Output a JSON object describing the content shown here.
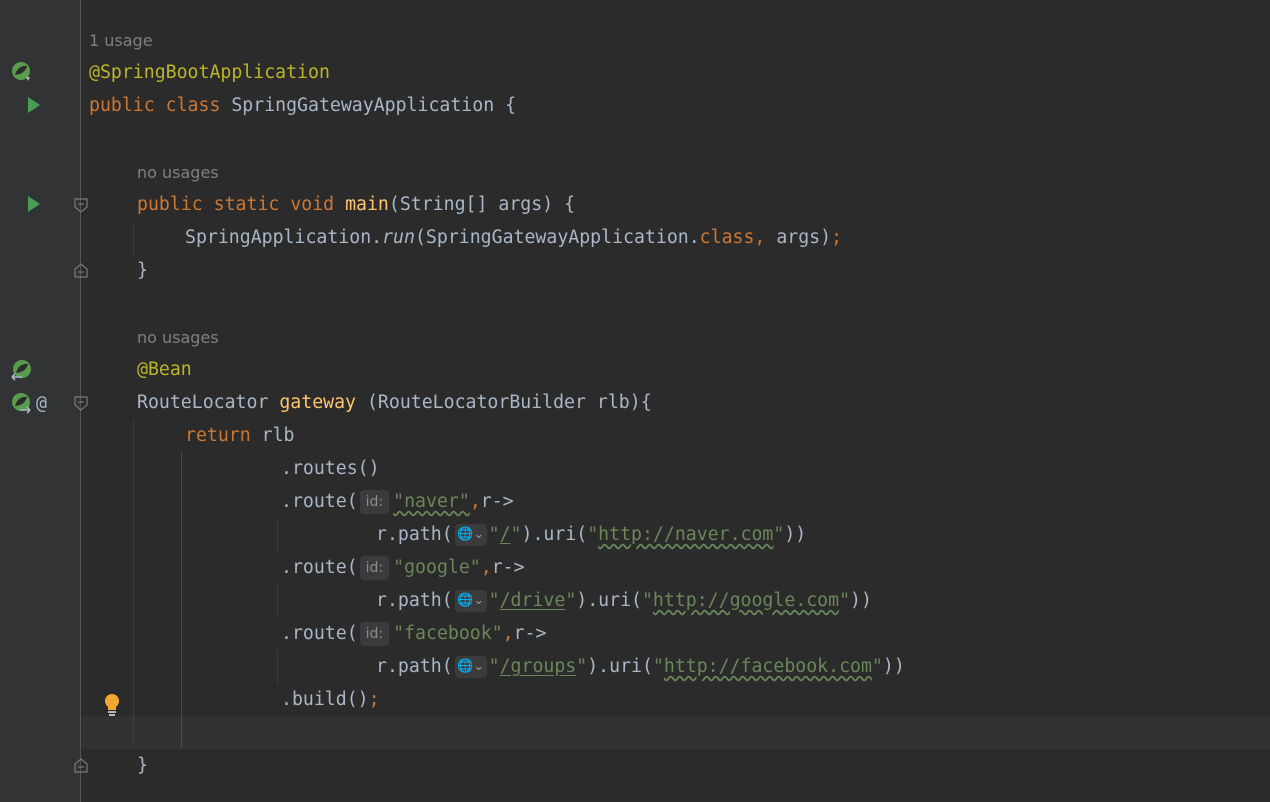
{
  "hints": {
    "class_usage": "1 usage",
    "main_usage": "no usages",
    "gateway_usage": "no usages"
  },
  "code": {
    "l_annotation": "@SpringBootApplication",
    "l_class_public": "public",
    "l_class_class": "class",
    "l_class_name": " SpringGatewayApplication {",
    "l_main_public": "public",
    "l_main_static": "static",
    "l_main_void": "void",
    "l_main_name": "main",
    "l_main_params": "(String[] args) {",
    "l_run_obj": "SpringApplication.",
    "l_run_method": "run",
    "l_run_args": "(SpringGatewayApplication.",
    "l_run_class": "class",
    "l_run_comma": ",",
    "l_run_rest": " args)",
    "l_run_semi": ";",
    "l_close_brace": "}",
    "l_bean": "@Bean",
    "l_gw_type": "RouteLocator ",
    "l_gw_name": "gateway",
    "l_gw_params": " (RouteLocatorBuilder rlb){",
    "l_return": "return",
    "l_rlb": " rlb",
    "l_routes": ".routes()",
    "route_prefix": ".route(",
    "param_hint": "id:",
    "route1_id": "\"naver\"",
    "route2_id": "\"google\"",
    "route3_id": "\"facebook\"",
    "route_comma": ",",
    "route_lambda": "r->",
    "path_prefix": "r.path(",
    "globe_glyph": "🌐⌄",
    "quote": "\"",
    "path1": "/",
    "path2": "/drive",
    "path3": "/groups",
    "uri_mid": ").uri(",
    "uri1": "http://naver.com",
    "uri2": "http://google.com",
    "uri3": "http://facebook.com",
    "uri_end": "))",
    "build": ".build()",
    "build_semi": ";",
    "at_sign": "@"
  },
  "icons": [
    "spring-bean-icon",
    "run-icon",
    "fold-icon",
    "lightbulb-icon"
  ],
  "colors": {
    "background": "#2b2b2b",
    "gutter": "#313335",
    "keyword": "#cc7832",
    "annotation": "#bbb529",
    "function": "#ffc66d",
    "string": "#6a8759",
    "text": "#a9b7c6",
    "run_green": "#499c54"
  }
}
